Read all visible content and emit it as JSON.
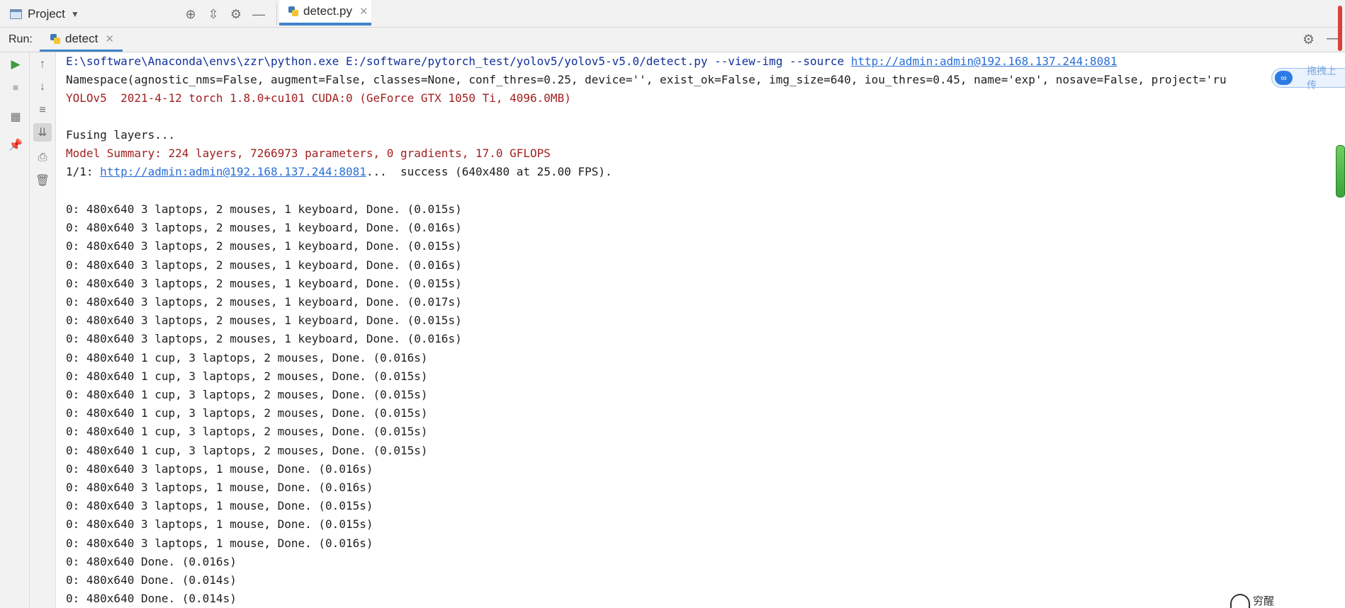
{
  "topbar": {
    "project_label": "Project",
    "project_caret": "▼",
    "icons": [
      "target-icon",
      "collapse-icon",
      "gear-icon",
      "minimize-icon"
    ],
    "tab": {
      "label": "detect.py",
      "close": "✕"
    }
  },
  "runbar": {
    "label": "Run:",
    "tab_label": "detect",
    "close": "✕"
  },
  "gutter": {
    "left": [
      "run-icon",
      "stop-icon",
      "layout-icon",
      "pin-icon"
    ],
    "right": [
      "up-icon",
      "down-icon",
      "soft-wrap-icon",
      "scroll-to-end-icon",
      "print-icon",
      "trash-icon"
    ]
  },
  "console": {
    "command_prefix": "E:\\software\\Anaconda\\envs\\zzr\\python.exe E:/software/pytorch_test/yolov5/yolov5-v5.0/detect.py --view-img --source ",
    "command_link": "http://admin:admin@192.168.137.244:8081",
    "namespace": "Namespace(agnostic_nms=False, augment=False, classes=None, conf_thres=0.25, device='', exist_ok=False, img_size=640, iou_thres=0.45, name='exp', nosave=False, project='ru",
    "yolo_version": "YOLOv5  2021-4-12 torch 1.8.0+cu101 CUDA:0 (GeForce GTX 1050 Ti, 4096.0MB)",
    "fusing": "Fusing layers...",
    "model_summary": "Model Summary: 224 layers, 7266973 parameters, 0 gradients, 17.0 GFLOPS",
    "source_prefix": "1/1: ",
    "source_link": "http://admin:admin@192.168.137.244:8081",
    "source_suffix": "...  success (640x480 at 25.00 FPS).",
    "detections": [
      "0: 480x640 3 laptops, 2 mouses, 1 keyboard, Done. (0.015s)",
      "0: 480x640 3 laptops, 2 mouses, 1 keyboard, Done. (0.016s)",
      "0: 480x640 3 laptops, 2 mouses, 1 keyboard, Done. (0.015s)",
      "0: 480x640 3 laptops, 2 mouses, 1 keyboard, Done. (0.016s)",
      "0: 480x640 3 laptops, 2 mouses, 1 keyboard, Done. (0.015s)",
      "0: 480x640 3 laptops, 2 mouses, 1 keyboard, Done. (0.017s)",
      "0: 480x640 3 laptops, 2 mouses, 1 keyboard, Done. (0.015s)",
      "0: 480x640 3 laptops, 2 mouses, 1 keyboard, Done. (0.016s)",
      "0: 480x640 1 cup, 3 laptops, 2 mouses, Done. (0.016s)",
      "0: 480x640 1 cup, 3 laptops, 2 mouses, Done. (0.015s)",
      "0: 480x640 1 cup, 3 laptops, 2 mouses, Done. (0.015s)",
      "0: 480x640 1 cup, 3 laptops, 2 mouses, Done. (0.015s)",
      "0: 480x640 1 cup, 3 laptops, 2 mouses, Done. (0.015s)",
      "0: 480x640 1 cup, 3 laptops, 2 mouses, Done. (0.015s)",
      "0: 480x640 3 laptops, 1 mouse, Done. (0.016s)",
      "0: 480x640 3 laptops, 1 mouse, Done. (0.016s)",
      "0: 480x640 3 laptops, 1 mouse, Done. (0.015s)",
      "0: 480x640 3 laptops, 1 mouse, Done. (0.015s)",
      "0: 480x640 3 laptops, 1 mouse, Done. (0.016s)",
      "0: 480x640 Done. (0.016s)",
      "0: 480x640 Done. (0.014s)",
      "0: 480x640 Done. (0.014s)"
    ]
  },
  "overlay": {
    "float_text": "拖拽上传",
    "corner_text": "穷醒"
  },
  "colors": {
    "error_red": "#a22020",
    "command_blue": "#12309a",
    "link_blue": "#2a6fd6",
    "accent": "#4083c9"
  }
}
